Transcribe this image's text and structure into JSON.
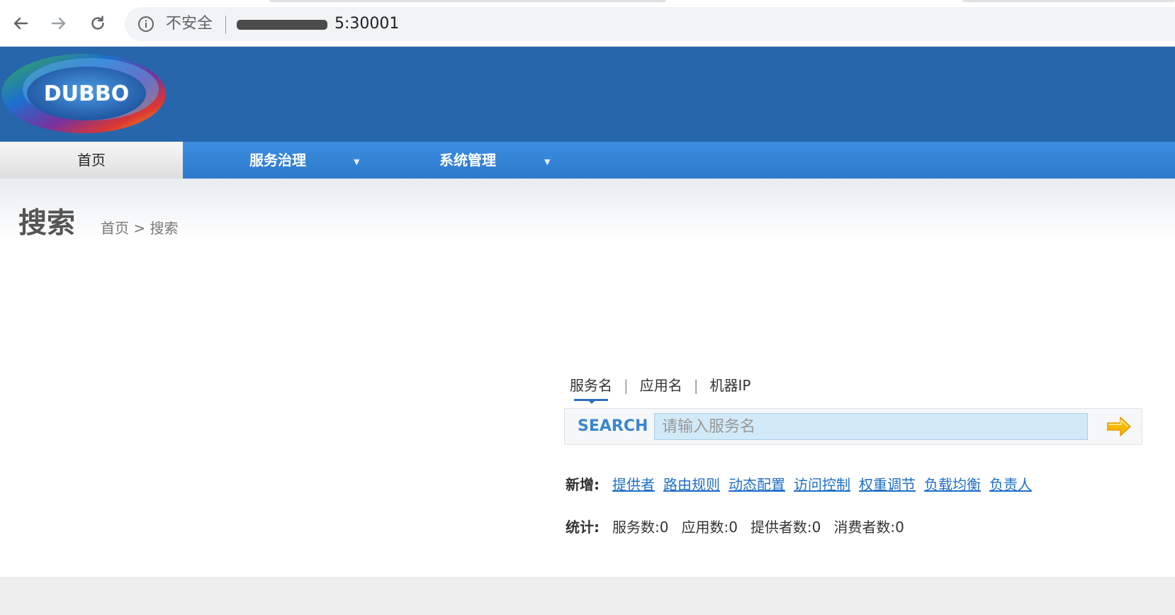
{
  "browser": {
    "security_text": "不安全",
    "url_text": "5:30001"
  },
  "logo": {
    "text": "DUBBO"
  },
  "menu": {
    "home": "首页",
    "service_governance": "服务治理",
    "system_management": "系统管理"
  },
  "page": {
    "title": "搜索",
    "breadcrumb": "首页 > 搜索"
  },
  "search": {
    "tabs": [
      "服务名",
      "应用名",
      "机器IP"
    ],
    "active_tab": "服务名",
    "label": "SEARCH",
    "placeholder": "请输入服务名"
  },
  "add_row": {
    "label": "新增:",
    "links": [
      "提供者",
      "路由规则",
      "动态配置",
      "访问控制",
      "权重调节",
      "负载均衡",
      "负责人"
    ]
  },
  "stats_row": {
    "label": "统计:",
    "items": [
      "服务数:0",
      "应用数:0",
      "提供者数:0",
      "消费者数:0"
    ]
  },
  "colors": {
    "header_blue": "#2766aa",
    "menu_blue": "#3b8ee0",
    "link_blue": "#1f6fc8",
    "search_input_bg": "#d2e9f8",
    "arrow_orange": "#f5b800"
  }
}
